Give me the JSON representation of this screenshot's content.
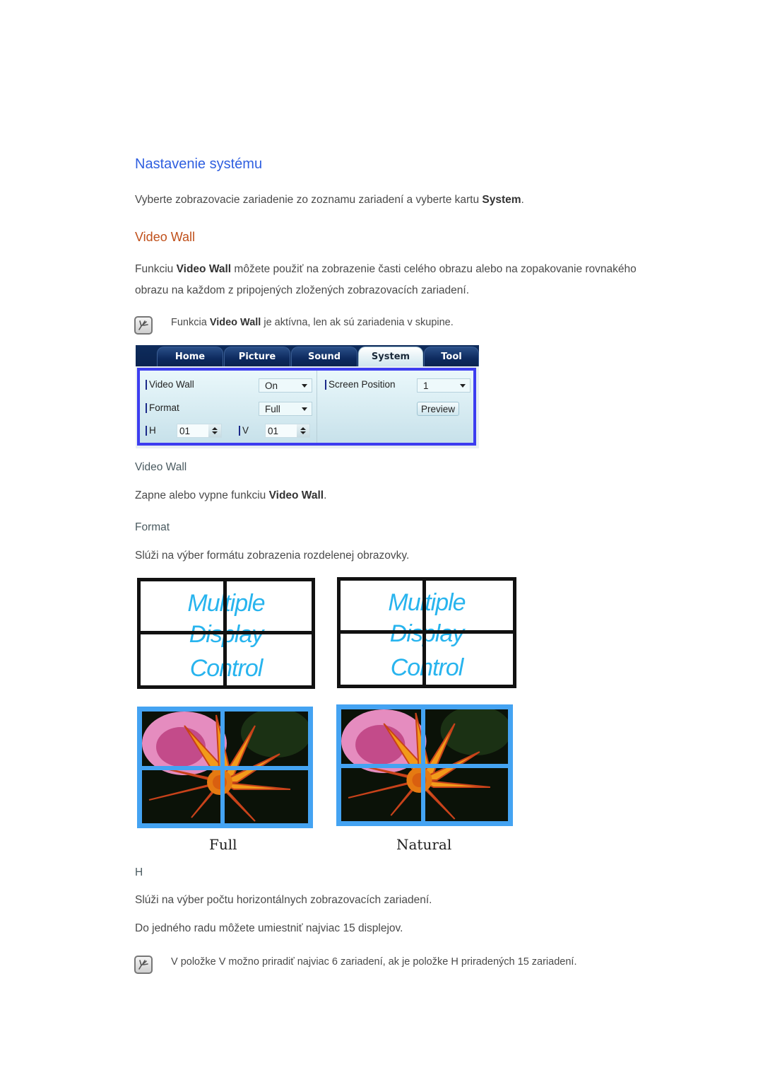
{
  "section_title": "Nastavenie systému",
  "intro": {
    "text_before": "Vyberte zobrazovacie zariadenie zo zoznamu zariadení a vyberte kartu ",
    "bold": "System",
    "text_after": "."
  },
  "video_wall_heading": "Video Wall",
  "description": {
    "line1_before": "Funkciu ",
    "line1_bold": "Video Wall",
    "line1_after": " môžete použiť na zobrazenie časti celého obrazu alebo na zopakovanie rovnakého",
    "line2": "obrazu na každom z pripojených zložených zobrazovacích zariadení."
  },
  "note1": {
    "icon": "note-pencil-icon",
    "text_before": "Funkcia ",
    "bold": "Video Wall",
    "text_after": " je aktívna, len ak sú zariadenia v skupine."
  },
  "panel": {
    "tabs": [
      {
        "label": "Home",
        "active": false
      },
      {
        "label": "Picture",
        "active": false
      },
      {
        "label": "Sound",
        "active": false
      },
      {
        "label": "System",
        "active": true
      },
      {
        "label": "Tool",
        "active": false
      }
    ],
    "video_wall": {
      "label": "Video Wall",
      "value": "On"
    },
    "format": {
      "label": "Format",
      "value": "Full"
    },
    "h": {
      "label": "H",
      "value": "01"
    },
    "v": {
      "label": "V",
      "value": "01"
    },
    "screen_position": {
      "label": "Screen Position",
      "value": "1"
    },
    "preview_button": "Preview"
  },
  "video_wall_section": {
    "title": "Video Wall",
    "text_before": "Zapne alebo vypne funkciu ",
    "bold": "Video Wall",
    "text_after": "."
  },
  "format_section": {
    "title": "Format",
    "text": "Slúži na výber formátu zobrazenia rozdelenej obrazovky."
  },
  "figures": {
    "mdc_lines": [
      "Multiple",
      "Display",
      "Control"
    ],
    "captions": [
      "Full",
      "Natural"
    ]
  },
  "h_section": {
    "title": "H",
    "line1": "Slúži na výber počtu horizontálnych zobrazovacích zariadení.",
    "line2": "Do jedného radu môžete umiestniť najviac 15 displejov."
  },
  "note2": {
    "icon": "note-pencil-icon",
    "text": "V položke V možno priradiť najviac 6 zariadení, ak je položke H priradených 15 zariadení."
  }
}
